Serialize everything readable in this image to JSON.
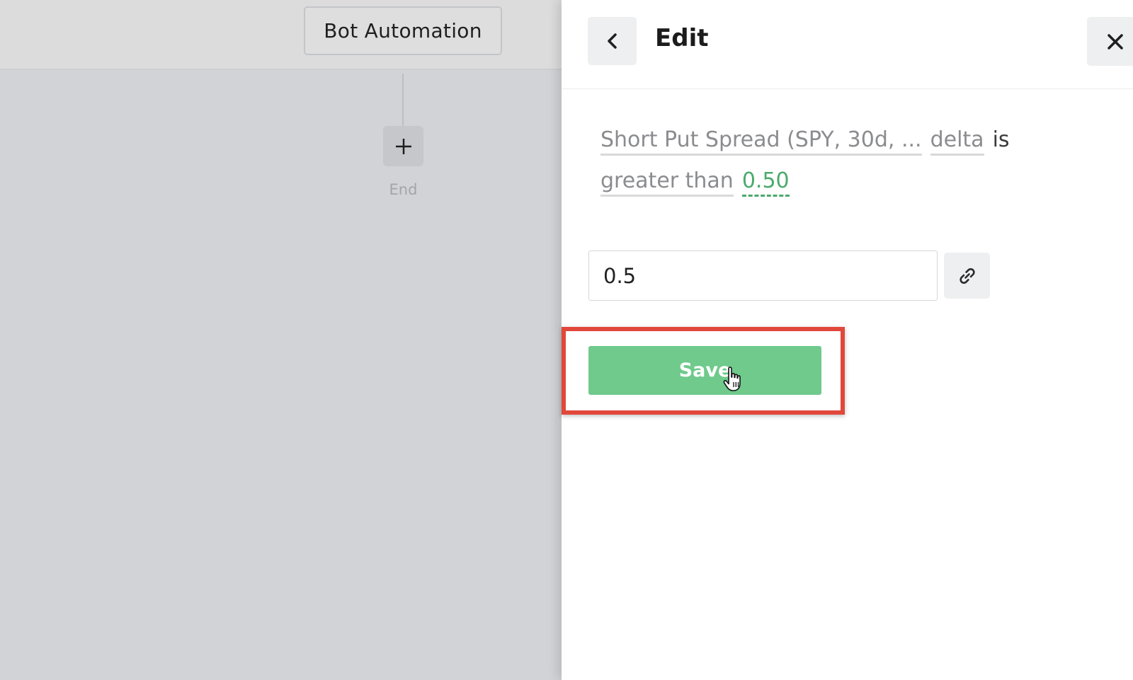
{
  "canvas": {
    "bot_title": "Bot Automation",
    "end_label": "End",
    "add_icon": "plus-icon"
  },
  "panel": {
    "title": "Edit",
    "back_icon": "chevron-left-icon",
    "close_icon": "close-icon",
    "condition": {
      "subject": "Short Put Spread (SPY, 30d, ...",
      "field": "delta",
      "verb": "is",
      "operator": "greater than",
      "value": "0.50"
    },
    "input_value": "0.5",
    "link_icon": "link-icon",
    "save_label": "Save"
  },
  "colors": {
    "accent_green": "#6fca8c",
    "value_green": "#4aaa6c",
    "highlight_red": "#e1473a"
  }
}
